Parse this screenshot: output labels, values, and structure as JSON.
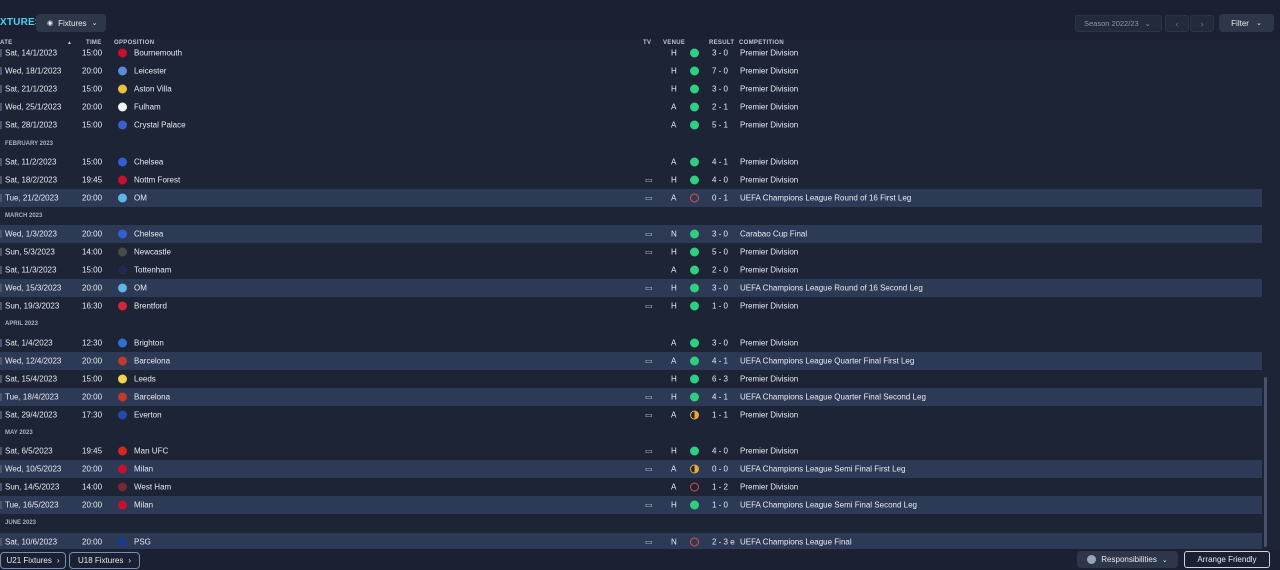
{
  "page": {
    "title": "XTURES"
  },
  "toolbar": {
    "view_label": "Fixtures",
    "season_label": "Season 2022/23",
    "filter_label": "Filter"
  },
  "columns": {
    "date": "ATE",
    "time": "TIME",
    "opposition": "OPPOSITION",
    "tv": "TV",
    "venue": "VENUE",
    "result": "RESULT",
    "competition": "COMPETITION"
  },
  "colors": {
    "win": "#2fcf82",
    "loss": "#e0504a",
    "draw": "#eba83a"
  },
  "rows": [
    {
      "type": "match",
      "date": "Sat, 14/1/2023",
      "time": "15:00",
      "opp": "Bournemouth",
      "badge": "#c8102e",
      "tv": false,
      "venue": "H",
      "outcome": "win",
      "result": "3 - 0",
      "comp": "Premier Division",
      "alt": false
    },
    {
      "type": "match",
      "date": "Wed, 18/1/2023",
      "time": "20:00",
      "opp": "Leicester",
      "badge": "#5a8ad8",
      "tv": false,
      "venue": "H",
      "outcome": "win",
      "result": "7 - 0",
      "comp": "Premier Division",
      "alt": false
    },
    {
      "type": "match",
      "date": "Sat, 21/1/2023",
      "time": "15:00",
      "opp": "Aston Villa",
      "badge": "#e9c13a",
      "tv": false,
      "venue": "H",
      "outcome": "win",
      "result": "3 - 0",
      "comp": "Premier Division",
      "alt": false
    },
    {
      "type": "match",
      "date": "Wed, 25/1/2023",
      "time": "20:00",
      "opp": "Fulham",
      "badge": "#f2f2f2",
      "tv": false,
      "venue": "A",
      "outcome": "win",
      "result": "2 - 1",
      "comp": "Premier Division",
      "alt": false
    },
    {
      "type": "match",
      "date": "Sat, 28/1/2023",
      "time": "15:00",
      "opp": "Crystal Palace",
      "badge": "#3a5fcc",
      "tv": false,
      "venue": "A",
      "outcome": "win",
      "result": "5 - 1",
      "comp": "Premier Division",
      "alt": false
    },
    {
      "type": "month",
      "label": "FEBRUARY 2023"
    },
    {
      "type": "match",
      "date": "Sat, 11/2/2023",
      "time": "15:00",
      "opp": "Chelsea",
      "badge": "#2f5fd0",
      "tv": false,
      "venue": "A",
      "outcome": "win",
      "result": "4 - 1",
      "comp": "Premier Division",
      "alt": false
    },
    {
      "type": "match",
      "date": "Sat, 18/2/2023",
      "time": "19:45",
      "opp": "Nottm Forest",
      "badge": "#c8102e",
      "tv": true,
      "venue": "H",
      "outcome": "win",
      "result": "4 - 0",
      "comp": "Premier Division",
      "alt": false
    },
    {
      "type": "match",
      "date": "Tue, 21/2/2023",
      "time": "20:00",
      "opp": "OM",
      "badge": "#5bb7e6",
      "tv": true,
      "venue": "A",
      "outcome": "loss",
      "result": "0 - 1",
      "comp": "UEFA Champions League Round of 16 First Leg",
      "alt": true
    },
    {
      "type": "month",
      "label": "MARCH 2023"
    },
    {
      "type": "match",
      "date": "Wed, 1/3/2023",
      "time": "20:00",
      "opp": "Chelsea",
      "badge": "#2f5fd0",
      "tv": true,
      "venue": "N",
      "outcome": "win",
      "result": "3 - 0",
      "comp": "Carabao Cup Final",
      "alt": true
    },
    {
      "type": "match",
      "date": "Sun, 5/3/2023",
      "time": "14:00",
      "opp": "Newcastle",
      "badge": "#4a4a4a",
      "tv": true,
      "venue": "H",
      "outcome": "win",
      "result": "5 - 0",
      "comp": "Premier Division",
      "alt": false
    },
    {
      "type": "match",
      "date": "Sat, 11/3/2023",
      "time": "15:00",
      "opp": "Tottenham",
      "badge": "#1e2a52",
      "tv": false,
      "venue": "A",
      "outcome": "win",
      "result": "2 - 0",
      "comp": "Premier Division",
      "alt": false
    },
    {
      "type": "match",
      "date": "Wed, 15/3/2023",
      "time": "20:00",
      "opp": "OM",
      "badge": "#5bb7e6",
      "tv": true,
      "venue": "H",
      "outcome": "win",
      "result": "3 - 0",
      "comp": "UEFA Champions League Round of 16 Second Leg",
      "alt": true
    },
    {
      "type": "match",
      "date": "Sun, 19/3/2023",
      "time": "16:30",
      "opp": "Brentford",
      "badge": "#d4243a",
      "tv": true,
      "venue": "H",
      "outcome": "win",
      "result": "1 - 0",
      "comp": "Premier Division",
      "alt": false
    },
    {
      "type": "month",
      "label": "APRIL 2023"
    },
    {
      "type": "match",
      "date": "Sat, 1/4/2023",
      "time": "12:30",
      "opp": "Brighton",
      "badge": "#2f6fd6",
      "tv": false,
      "venue": "A",
      "outcome": "win",
      "result": "3 - 0",
      "comp": "Premier Division",
      "alt": false
    },
    {
      "type": "match",
      "date": "Wed, 12/4/2023",
      "time": "20:00",
      "opp": "Barcelona",
      "badge": "#c0392b",
      "tv": true,
      "venue": "A",
      "outcome": "win",
      "result": "4 - 1",
      "comp": "UEFA Champions League Quarter Final First Leg",
      "alt": true
    },
    {
      "type": "match",
      "date": "Sat, 15/4/2023",
      "time": "15:00",
      "opp": "Leeds",
      "badge": "#f0d64a",
      "tv": false,
      "venue": "H",
      "outcome": "win",
      "result": "6 - 3",
      "comp": "Premier Division",
      "alt": false
    },
    {
      "type": "match",
      "date": "Tue, 18/4/2023",
      "time": "20:00",
      "opp": "Barcelona",
      "badge": "#c0392b",
      "tv": true,
      "venue": "H",
      "outcome": "win",
      "result": "4 - 1",
      "comp": "UEFA Champions League Quarter Final Second Leg",
      "alt": true
    },
    {
      "type": "match",
      "date": "Sat, 29/4/2023",
      "time": "17:30",
      "opp": "Everton",
      "badge": "#2548b0",
      "tv": true,
      "venue": "A",
      "outcome": "draw",
      "result": "1 - 1",
      "comp": "Premier Division",
      "alt": false
    },
    {
      "type": "month",
      "label": "MAY 2023"
    },
    {
      "type": "match",
      "date": "Sat, 6/5/2023",
      "time": "19:45",
      "opp": "Man UFC",
      "badge": "#d7261e",
      "tv": true,
      "venue": "H",
      "outcome": "win",
      "result": "4 - 0",
      "comp": "Premier Division",
      "alt": false
    },
    {
      "type": "match",
      "date": "Wed, 10/5/2023",
      "time": "20:00",
      "opp": "Milan",
      "badge": "#c8102e",
      "tv": true,
      "venue": "A",
      "outcome": "draw",
      "result": "0 - 0",
      "comp": "UEFA Champions League Semi Final First Leg",
      "alt": true
    },
    {
      "type": "match",
      "date": "Sun, 14/5/2023",
      "time": "14:00",
      "opp": "West Ham",
      "badge": "#7a2638",
      "tv": false,
      "venue": "A",
      "outcome": "loss",
      "result": "1 - 2",
      "comp": "Premier Division",
      "alt": false
    },
    {
      "type": "match",
      "date": "Tue, 16/5/2023",
      "time": "20:00",
      "opp": "Milan",
      "badge": "#c8102e",
      "tv": true,
      "venue": "H",
      "outcome": "win",
      "result": "1 - 0",
      "comp": "UEFA Champions League Semi Final Second Leg",
      "alt": true
    },
    {
      "type": "month",
      "label": "JUNE 2023"
    },
    {
      "type": "match",
      "date": "Sat, 10/6/2023",
      "time": "20:00",
      "opp": "PSG",
      "badge": "#1b3a8a",
      "tv": true,
      "venue": "N",
      "outcome": "loss",
      "result": "2 - 3 e",
      "comp": "UEFA Champions League Final",
      "alt": true
    }
  ],
  "bottom": {
    "u21_label": "U21 Fixtures",
    "u18_label": "U18 Fixtures",
    "responsibilities_label": "Responsibilities",
    "arrange_label": "Arrange Friendly"
  }
}
